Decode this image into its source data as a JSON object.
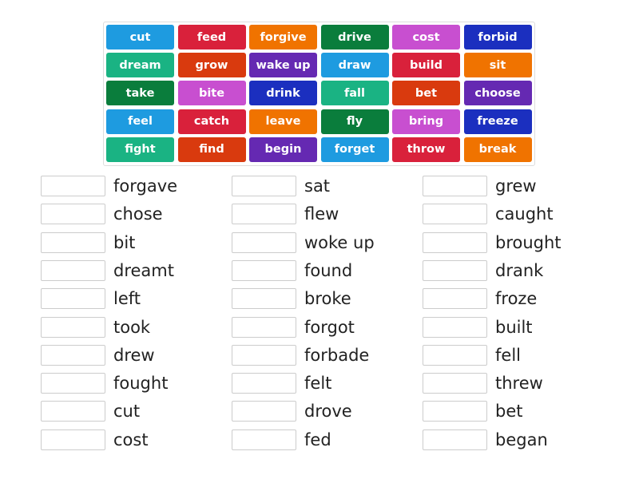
{
  "colors": {
    "blue": "#1e9be0",
    "red": "#d9213b",
    "orange": "#f07300",
    "darkgreen": "#0a7d3c",
    "pink": "#c84fd0",
    "navy": "#1b2fbf",
    "teal": "#1ab383",
    "redorange": "#d93a0e",
    "purple": "#6529b2"
  },
  "tiles": [
    {
      "label": "cut",
      "color": "blue"
    },
    {
      "label": "feed",
      "color": "red"
    },
    {
      "label": "forgive",
      "color": "orange"
    },
    {
      "label": "drive",
      "color": "darkgreen"
    },
    {
      "label": "cost",
      "color": "pink"
    },
    {
      "label": "forbid",
      "color": "navy"
    },
    {
      "label": "dream",
      "color": "teal"
    },
    {
      "label": "grow",
      "color": "redorange"
    },
    {
      "label": "wake up",
      "color": "purple"
    },
    {
      "label": "draw",
      "color": "blue"
    },
    {
      "label": "build",
      "color": "red"
    },
    {
      "label": "sit",
      "color": "orange"
    },
    {
      "label": "take",
      "color": "darkgreen"
    },
    {
      "label": "bite",
      "color": "pink"
    },
    {
      "label": "drink",
      "color": "navy"
    },
    {
      "label": "fall",
      "color": "teal"
    },
    {
      "label": "bet",
      "color": "redorange"
    },
    {
      "label": "choose",
      "color": "purple"
    },
    {
      "label": "feel",
      "color": "blue"
    },
    {
      "label": "catch",
      "color": "red"
    },
    {
      "label": "leave",
      "color": "orange"
    },
    {
      "label": "fly",
      "color": "darkgreen"
    },
    {
      "label": "bring",
      "color": "pink"
    },
    {
      "label": "freeze",
      "color": "navy"
    },
    {
      "label": "fight",
      "color": "teal"
    },
    {
      "label": "find",
      "color": "redorange"
    },
    {
      "label": "begin",
      "color": "purple"
    },
    {
      "label": "forget",
      "color": "blue"
    },
    {
      "label": "throw",
      "color": "red"
    },
    {
      "label": "break",
      "color": "orange"
    }
  ],
  "columns": [
    [
      "forgave",
      "chose",
      "bit",
      "dreamt",
      "left",
      "took",
      "drew",
      "fought",
      "cut",
      "cost"
    ],
    [
      "sat",
      "flew",
      "woke up",
      "found",
      "broke",
      "forgot",
      "forbade",
      "felt",
      "drove",
      "fed"
    ],
    [
      "grew",
      "caught",
      "brought",
      "drank",
      "froze",
      "built",
      "fell",
      "threw",
      "bet",
      "began"
    ]
  ]
}
